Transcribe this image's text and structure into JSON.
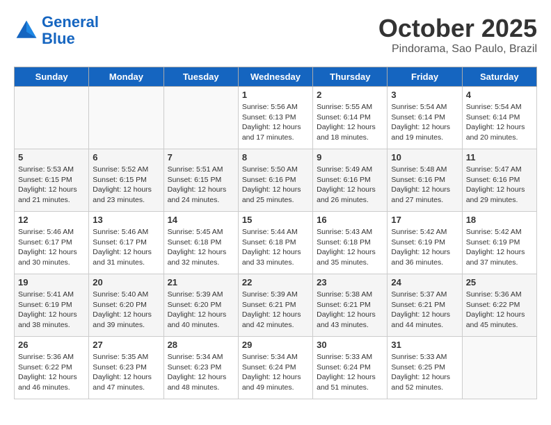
{
  "header": {
    "logo_line1": "General",
    "logo_line2": "Blue",
    "month": "October 2025",
    "location": "Pindorama, Sao Paulo, Brazil"
  },
  "weekdays": [
    "Sunday",
    "Monday",
    "Tuesday",
    "Wednesday",
    "Thursday",
    "Friday",
    "Saturday"
  ],
  "weeks": [
    [
      {
        "day": "",
        "sunrise": "",
        "sunset": "",
        "daylight": ""
      },
      {
        "day": "",
        "sunrise": "",
        "sunset": "",
        "daylight": ""
      },
      {
        "day": "",
        "sunrise": "",
        "sunset": "",
        "daylight": ""
      },
      {
        "day": "1",
        "sunrise": "Sunrise: 5:56 AM",
        "sunset": "Sunset: 6:13 PM",
        "daylight": "Daylight: 12 hours and 17 minutes."
      },
      {
        "day": "2",
        "sunrise": "Sunrise: 5:55 AM",
        "sunset": "Sunset: 6:14 PM",
        "daylight": "Daylight: 12 hours and 18 minutes."
      },
      {
        "day": "3",
        "sunrise": "Sunrise: 5:54 AM",
        "sunset": "Sunset: 6:14 PM",
        "daylight": "Daylight: 12 hours and 19 minutes."
      },
      {
        "day": "4",
        "sunrise": "Sunrise: 5:54 AM",
        "sunset": "Sunset: 6:14 PM",
        "daylight": "Daylight: 12 hours and 20 minutes."
      }
    ],
    [
      {
        "day": "5",
        "sunrise": "Sunrise: 5:53 AM",
        "sunset": "Sunset: 6:15 PM",
        "daylight": "Daylight: 12 hours and 21 minutes."
      },
      {
        "day": "6",
        "sunrise": "Sunrise: 5:52 AM",
        "sunset": "Sunset: 6:15 PM",
        "daylight": "Daylight: 12 hours and 23 minutes."
      },
      {
        "day": "7",
        "sunrise": "Sunrise: 5:51 AM",
        "sunset": "Sunset: 6:15 PM",
        "daylight": "Daylight: 12 hours and 24 minutes."
      },
      {
        "day": "8",
        "sunrise": "Sunrise: 5:50 AM",
        "sunset": "Sunset: 6:16 PM",
        "daylight": "Daylight: 12 hours and 25 minutes."
      },
      {
        "day": "9",
        "sunrise": "Sunrise: 5:49 AM",
        "sunset": "Sunset: 6:16 PM",
        "daylight": "Daylight: 12 hours and 26 minutes."
      },
      {
        "day": "10",
        "sunrise": "Sunrise: 5:48 AM",
        "sunset": "Sunset: 6:16 PM",
        "daylight": "Daylight: 12 hours and 27 minutes."
      },
      {
        "day": "11",
        "sunrise": "Sunrise: 5:47 AM",
        "sunset": "Sunset: 6:16 PM",
        "daylight": "Daylight: 12 hours and 29 minutes."
      }
    ],
    [
      {
        "day": "12",
        "sunrise": "Sunrise: 5:46 AM",
        "sunset": "Sunset: 6:17 PM",
        "daylight": "Daylight: 12 hours and 30 minutes."
      },
      {
        "day": "13",
        "sunrise": "Sunrise: 5:46 AM",
        "sunset": "Sunset: 6:17 PM",
        "daylight": "Daylight: 12 hours and 31 minutes."
      },
      {
        "day": "14",
        "sunrise": "Sunrise: 5:45 AM",
        "sunset": "Sunset: 6:18 PM",
        "daylight": "Daylight: 12 hours and 32 minutes."
      },
      {
        "day": "15",
        "sunrise": "Sunrise: 5:44 AM",
        "sunset": "Sunset: 6:18 PM",
        "daylight": "Daylight: 12 hours and 33 minutes."
      },
      {
        "day": "16",
        "sunrise": "Sunrise: 5:43 AM",
        "sunset": "Sunset: 6:18 PM",
        "daylight": "Daylight: 12 hours and 35 minutes."
      },
      {
        "day": "17",
        "sunrise": "Sunrise: 5:42 AM",
        "sunset": "Sunset: 6:19 PM",
        "daylight": "Daylight: 12 hours and 36 minutes."
      },
      {
        "day": "18",
        "sunrise": "Sunrise: 5:42 AM",
        "sunset": "Sunset: 6:19 PM",
        "daylight": "Daylight: 12 hours and 37 minutes."
      }
    ],
    [
      {
        "day": "19",
        "sunrise": "Sunrise: 5:41 AM",
        "sunset": "Sunset: 6:19 PM",
        "daylight": "Daylight: 12 hours and 38 minutes."
      },
      {
        "day": "20",
        "sunrise": "Sunrise: 5:40 AM",
        "sunset": "Sunset: 6:20 PM",
        "daylight": "Daylight: 12 hours and 39 minutes."
      },
      {
        "day": "21",
        "sunrise": "Sunrise: 5:39 AM",
        "sunset": "Sunset: 6:20 PM",
        "daylight": "Daylight: 12 hours and 40 minutes."
      },
      {
        "day": "22",
        "sunrise": "Sunrise: 5:39 AM",
        "sunset": "Sunset: 6:21 PM",
        "daylight": "Daylight: 12 hours and 42 minutes."
      },
      {
        "day": "23",
        "sunrise": "Sunrise: 5:38 AM",
        "sunset": "Sunset: 6:21 PM",
        "daylight": "Daylight: 12 hours and 43 minutes."
      },
      {
        "day": "24",
        "sunrise": "Sunrise: 5:37 AM",
        "sunset": "Sunset: 6:21 PM",
        "daylight": "Daylight: 12 hours and 44 minutes."
      },
      {
        "day": "25",
        "sunrise": "Sunrise: 5:36 AM",
        "sunset": "Sunset: 6:22 PM",
        "daylight": "Daylight: 12 hours and 45 minutes."
      }
    ],
    [
      {
        "day": "26",
        "sunrise": "Sunrise: 5:36 AM",
        "sunset": "Sunset: 6:22 PM",
        "daylight": "Daylight: 12 hours and 46 minutes."
      },
      {
        "day": "27",
        "sunrise": "Sunrise: 5:35 AM",
        "sunset": "Sunset: 6:23 PM",
        "daylight": "Daylight: 12 hours and 47 minutes."
      },
      {
        "day": "28",
        "sunrise": "Sunrise: 5:34 AM",
        "sunset": "Sunset: 6:23 PM",
        "daylight": "Daylight: 12 hours and 48 minutes."
      },
      {
        "day": "29",
        "sunrise": "Sunrise: 5:34 AM",
        "sunset": "Sunset: 6:24 PM",
        "daylight": "Daylight: 12 hours and 49 minutes."
      },
      {
        "day": "30",
        "sunrise": "Sunrise: 5:33 AM",
        "sunset": "Sunset: 6:24 PM",
        "daylight": "Daylight: 12 hours and 51 minutes."
      },
      {
        "day": "31",
        "sunrise": "Sunrise: 5:33 AM",
        "sunset": "Sunset: 6:25 PM",
        "daylight": "Daylight: 12 hours and 52 minutes."
      },
      {
        "day": "",
        "sunrise": "",
        "sunset": "",
        "daylight": ""
      }
    ]
  ]
}
